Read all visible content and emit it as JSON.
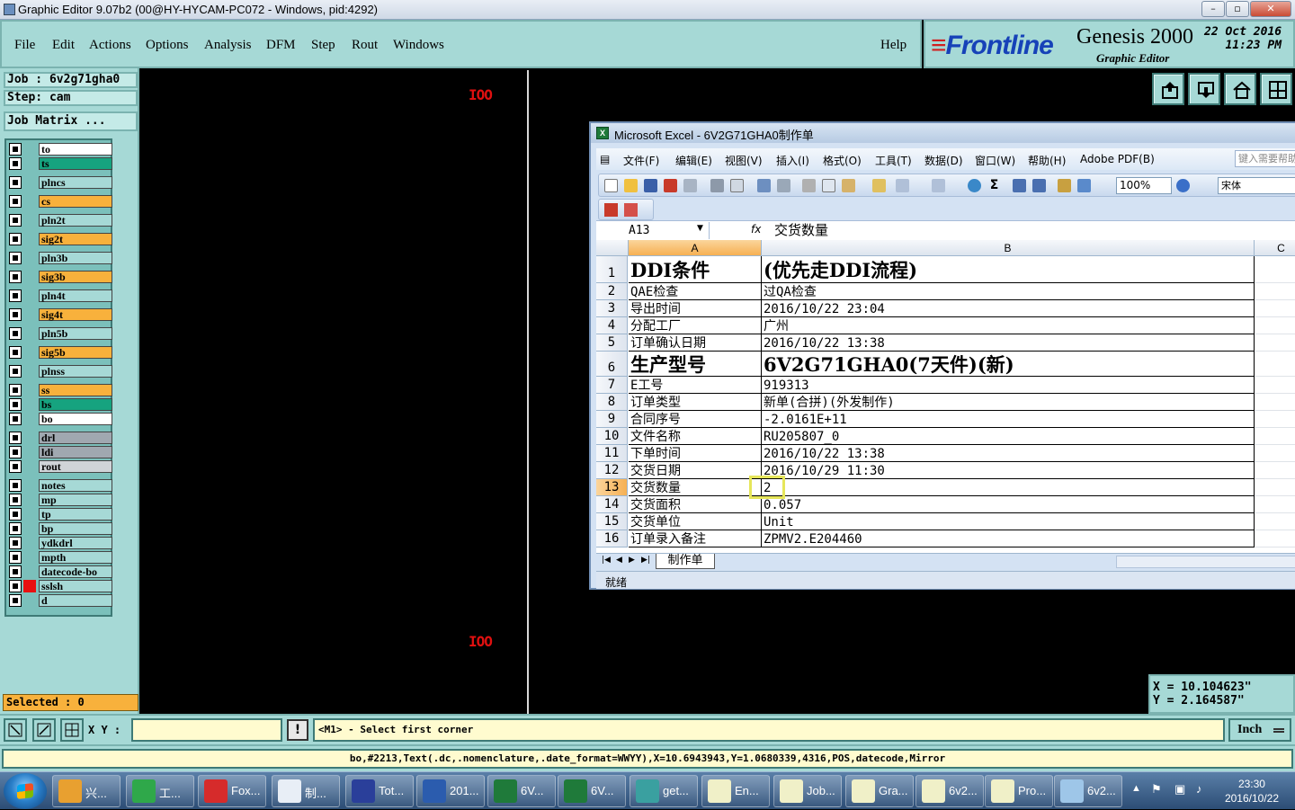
{
  "titlebar": {
    "title": "Graphic Editor 9.07b2 (00@HY-HYCAM-PC072 - Windows, pid:4292)",
    "min": "▭",
    "max": "▢",
    "close": "✕"
  },
  "menu": [
    "File",
    "Edit",
    "Actions",
    "Options",
    "Analysis",
    "DFM",
    "Step",
    "Rout",
    "Windows"
  ],
  "help": "Help",
  "brand": {
    "logo": "Frontline",
    "product": "Genesis 2000",
    "subtitle": "Graphic Editor",
    "date_line1": "22 Oct 2016",
    "date_line2": "11:23 PM"
  },
  "job": {
    "job_label": "Job : 6v2g71gha0",
    "step_label": "Step: cam",
    "matrix_button": "Job Matrix ..."
  },
  "layers": [
    {
      "name": "to",
      "color": "#ffffff"
    },
    {
      "name": "ts",
      "color": "#16a37f"
    },
    {
      "name": "plncs",
      "color": "#a6d9d6"
    },
    {
      "name": "cs",
      "color": "#f8b13c"
    },
    {
      "name": "pln2t",
      "color": "#a6d9d6"
    },
    {
      "name": "sig2t",
      "color": "#f8b13c"
    },
    {
      "name": "pln3b",
      "color": "#a6d9d6"
    },
    {
      "name": "sig3b",
      "color": "#f8b13c"
    },
    {
      "name": "pln4t",
      "color": "#a6d9d6"
    },
    {
      "name": "sig4t",
      "color": "#f8b13c"
    },
    {
      "name": "pln5b",
      "color": "#a6d9d6"
    },
    {
      "name": "sig5b",
      "color": "#f8b13c"
    },
    {
      "name": "plnss",
      "color": "#a6d9d6"
    },
    {
      "name": "ss",
      "color": "#f8b13c"
    },
    {
      "name": "bs",
      "color": "#16a37f"
    },
    {
      "name": "bo",
      "color": "#ffffff"
    },
    {
      "name": "drl",
      "color": "#a0a8b0"
    },
    {
      "name": "ldi",
      "color": "#a0a8b0"
    },
    {
      "name": "rout",
      "color": "#d0d4d8"
    },
    {
      "name": "notes",
      "color": "#a6d9d6"
    },
    {
      "name": "mp",
      "color": "#a6d9d6"
    },
    {
      "name": "tp",
      "color": "#a6d9d6"
    },
    {
      "name": "bp",
      "color": "#a6d9d6"
    },
    {
      "name": "ydkdrl",
      "color": "#a6d9d6"
    },
    {
      "name": "mpth",
      "color": "#a6d9d6"
    },
    {
      "name": "datecode-bo",
      "color": "#a6d9d6"
    },
    {
      "name": "sslsh",
      "color": "#a6d9d6"
    },
    {
      "name": "d",
      "color": "#a6d9d6"
    }
  ],
  "selected": "Selected : 0",
  "canvas_marks": {
    "top": "IOO",
    "bottom": "IOO"
  },
  "coords": {
    "x": "X = 10.104623\"",
    "y": "Y = 2.164587\""
  },
  "cmd": {
    "xy_label": "X Y :",
    "xy_value": "",
    "warn": "!",
    "prompt": "<M1> - Select first corner",
    "unit": "Inch"
  },
  "status_text": "bo,#2213,Text(.dc,.nomenclature,.date_format=WWYY),X=10.6943943,Y=1.0680339,4316,POS,datecode,Mirror",
  "excel": {
    "title": "Microsoft Excel - 6V2G71GHA0制作单",
    "menu": [
      "文件(F)",
      "编辑(E)",
      "视图(V)",
      "插入(I)",
      "格式(O)",
      "工具(T)",
      "数据(D)",
      "窗口(W)",
      "帮助(H)",
      "Adobe PDF(B)"
    ],
    "search_placeholder": "键入需要帮助",
    "zoom": "100%",
    "font": "宋体",
    "namebox": "A13",
    "fx": "fx",
    "formula": "交货数量",
    "columns": [
      "A",
      "B",
      "C"
    ],
    "rows": [
      {
        "num": "1",
        "a": "DDI条件",
        "b": "(优先走DDI流程)",
        "big": true
      },
      {
        "num": "2",
        "a": "QAE检查",
        "b": "过QA检查"
      },
      {
        "num": "3",
        "a": "导出时间",
        "b": "2016/10/22 23:04"
      },
      {
        "num": "4",
        "a": "分配工厂",
        "b": "广州"
      },
      {
        "num": "5",
        "a": "订单确认日期",
        "b": "2016/10/22 13:38"
      },
      {
        "num": "6",
        "a": "生产型号",
        "b": "6V2G71GHA0(7天件)(新)",
        "big": true
      },
      {
        "num": "7",
        "a": "E工号",
        "b": "919313"
      },
      {
        "num": "8",
        "a": "订单类型",
        "b": "新单(合拼)(外发制作)"
      },
      {
        "num": "9",
        "a": "合同序号",
        "b": "-2.0161E+11"
      },
      {
        "num": "10",
        "a": "文件名称",
        "b": "RU205807_0"
      },
      {
        "num": "11",
        "a": "下单时间",
        "b": "2016/10/22 13:38"
      },
      {
        "num": "12",
        "a": "交货日期",
        "b": "2016/10/29 11:30"
      },
      {
        "num": "13",
        "a": "交货数量",
        "b": "2"
      },
      {
        "num": "14",
        "a": "交货面积",
        "b": "0.057"
      },
      {
        "num": "15",
        "a": "交货单位",
        "b": "Unit"
      },
      {
        "num": "16",
        "a": "订单录入备注",
        "b": "ZPMV2.E204460"
      }
    ],
    "sheet_tab": "制作单",
    "status": "就绪"
  },
  "taskbar": {
    "items": [
      {
        "label": "兴...",
        "color": "#e8a030"
      },
      {
        "label": "工...",
        "color": "#2fa84a"
      },
      {
        "label": "Fox...",
        "color": "#d62b2b"
      },
      {
        "label": "制...",
        "color": "#e8eef6"
      },
      {
        "label": "Tot...",
        "color": "#2a3f9a"
      },
      {
        "label": "201...",
        "color": "#2b5cae"
      },
      {
        "label": "6V...",
        "color": "#1f7a3a"
      },
      {
        "label": "6V...",
        "color": "#1f7a3a"
      },
      {
        "label": "get...",
        "color": "#3aa0a0"
      },
      {
        "label": "En...",
        "color": "#f0f0c8"
      },
      {
        "label": "Job...",
        "color": "#f0f0c8"
      },
      {
        "label": "Gra...",
        "color": "#f0f0c8"
      },
      {
        "label": "6v2...",
        "color": "#f0f0c8"
      },
      {
        "label": "Pro...",
        "color": "#f0f0c8"
      },
      {
        "label": "6v2...",
        "color": "#9ec6e8"
      }
    ],
    "time": "23:30",
    "date": "2016/10/22"
  }
}
